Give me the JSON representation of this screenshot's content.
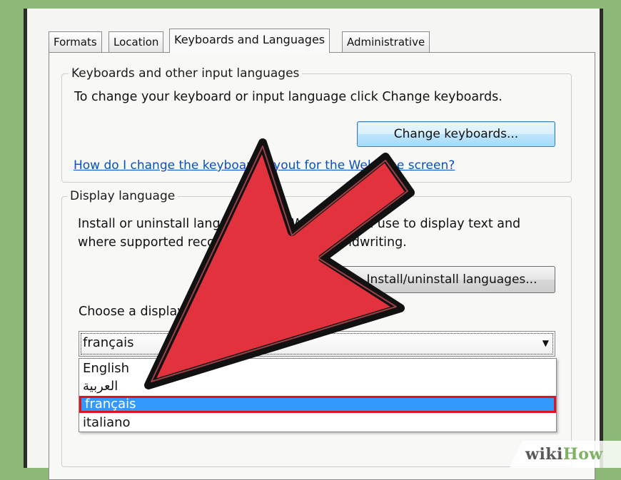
{
  "tabs": [
    {
      "label": "Formats"
    },
    {
      "label": "Location"
    },
    {
      "label": "Keyboards and Languages"
    },
    {
      "label": "Administrative"
    }
  ],
  "keyboards_group": {
    "legend": "Keyboards and other input languages",
    "description": "To change your keyboard or input language click Change keyboards.",
    "change_button": "Change keyboards...",
    "help_link": "How do I change the keyboard layout for the Welcome screen?"
  },
  "display_group": {
    "legend": "Display language",
    "description_line1": "Install or uninstall languages that Windows can use to display text and",
    "description_line2": "where supported recognize speech and handwriting.",
    "install_button": "Install/uninstall languages...",
    "choose_label": "Choose a display language:",
    "selected_value": "français",
    "options": [
      "English",
      "العربية",
      "français",
      "italiano"
    ],
    "selected_index": 2
  },
  "watermark": {
    "part1": "wiki",
    "part2": "How"
  },
  "colors": {
    "arrow_fill": "#e2323d",
    "arrow_outline": "#111111",
    "highlight_border": "#e0141c",
    "selection_blue": "#3399ff",
    "link_blue": "#0a4fc1",
    "background_green": "#8db878"
  },
  "icons": {
    "install_button_icon": "language-install-icon",
    "combo_arrow": "chevron-down-icon"
  }
}
